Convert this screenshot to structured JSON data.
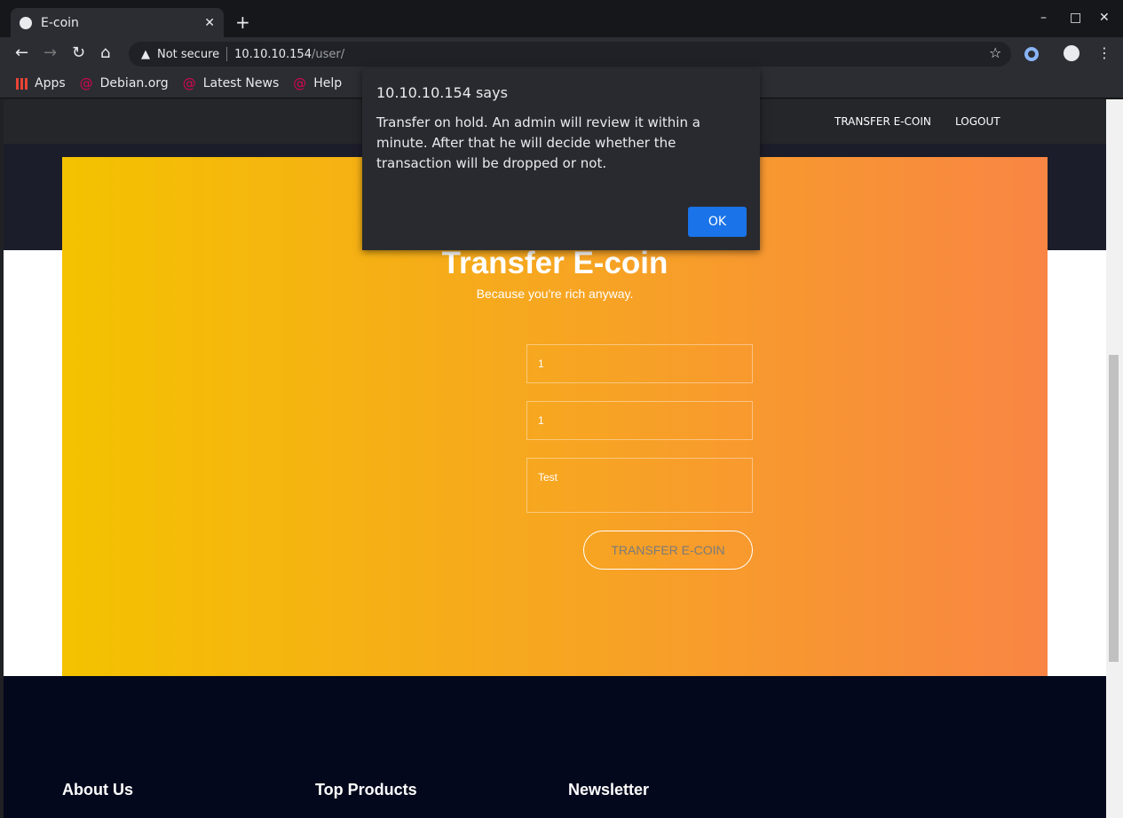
{
  "browser": {
    "tab_title": "E-coin",
    "url_security": "Not secure",
    "url_host": "10.10.10.154",
    "url_path": "/user/",
    "bookmarks": [
      {
        "label": "Apps"
      },
      {
        "label": "Debian.org"
      },
      {
        "label": "Latest News"
      },
      {
        "label": "Help"
      }
    ]
  },
  "site": {
    "nav": [
      "TRANSFER E-COIN",
      "LOGOUT"
    ],
    "title": "Transfer E-coin",
    "subtitle": "Because you're rich anyway.",
    "fields": {
      "field1": "1",
      "field2": "1",
      "message": "Test"
    },
    "submit": "TRANSFER E-COIN",
    "footer": [
      "About Us",
      "Top Products",
      "Newsletter"
    ]
  },
  "dialog": {
    "title": "10.10.10.154 says",
    "message": "Transfer on hold. An admin will review it within a minute. After that he will decide whether the transaction will be dropped or not.",
    "ok": "OK",
    "accent": "#1a73e8"
  }
}
